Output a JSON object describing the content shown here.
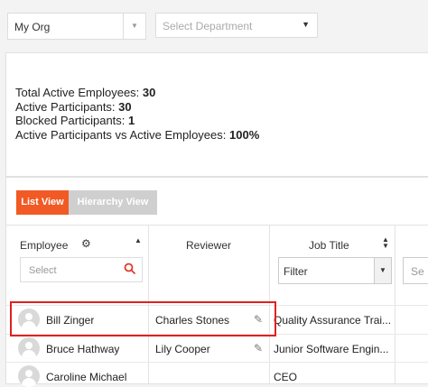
{
  "filters": {
    "org_value": "My Org",
    "dept_placeholder": "Select Department"
  },
  "stats": {
    "total_active_label": "Total Active Employees:",
    "total_active_value": "30",
    "active_participants_label": "Active Participants:",
    "active_participants_value": "30",
    "blocked_label": "Blocked Participants:",
    "blocked_value": "1",
    "ratio_label": "Active Participants vs Active Employees:",
    "ratio_value": "100%"
  },
  "tabs": {
    "list": "List View",
    "hierarchy": "Hierarchy View"
  },
  "columns": {
    "employee": "Employee",
    "reviewer": "Reviewer",
    "job_title": "Job Title"
  },
  "column_filters": {
    "employee_placeholder": "Select",
    "job_title_value": "Filter",
    "next_placeholder": "Se"
  },
  "rows": [
    {
      "employee": "Bill Zinger",
      "reviewer": "Charles Stones",
      "job_title": "Quality Assurance Trai..."
    },
    {
      "employee": "Bruce Hathway",
      "reviewer": "Lily Cooper",
      "job_title": "Junior Software Engin..."
    },
    {
      "employee": "Caroline Michael",
      "reviewer": "",
      "job_title": "CEO"
    }
  ]
}
